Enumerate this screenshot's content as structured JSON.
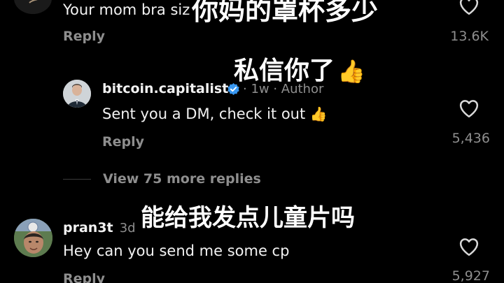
{
  "comments": [
    {
      "text": "Your mom bra siz",
      "reply_label": "Reply",
      "likes": "13.6K"
    },
    {
      "username": "bitcoin.capitalist",
      "meta": "· 1w · Author",
      "text": "Sent you a DM, check it out",
      "emoji": "👍",
      "reply_label": "Reply",
      "likes": "5,436"
    },
    {
      "username": "pran3t",
      "time": "3d",
      "text": "Hey can you send me some cp",
      "reply_label": "Reply",
      "likes": "5,927"
    }
  ],
  "view_more_label": "View 75 more replies",
  "captions": {
    "top": "你妈的罩杯多少",
    "middle": "私信你了",
    "middle_emoji": "👍",
    "bottom": "能给我发点儿童片吗"
  },
  "colors": {
    "background": "#000000",
    "text": "#f2f2f2",
    "secondary": "#8e8e8e",
    "verified": "#3897f0"
  },
  "icons": {
    "like": "heart-outline-icon",
    "verified": "verified-badge-icon"
  }
}
